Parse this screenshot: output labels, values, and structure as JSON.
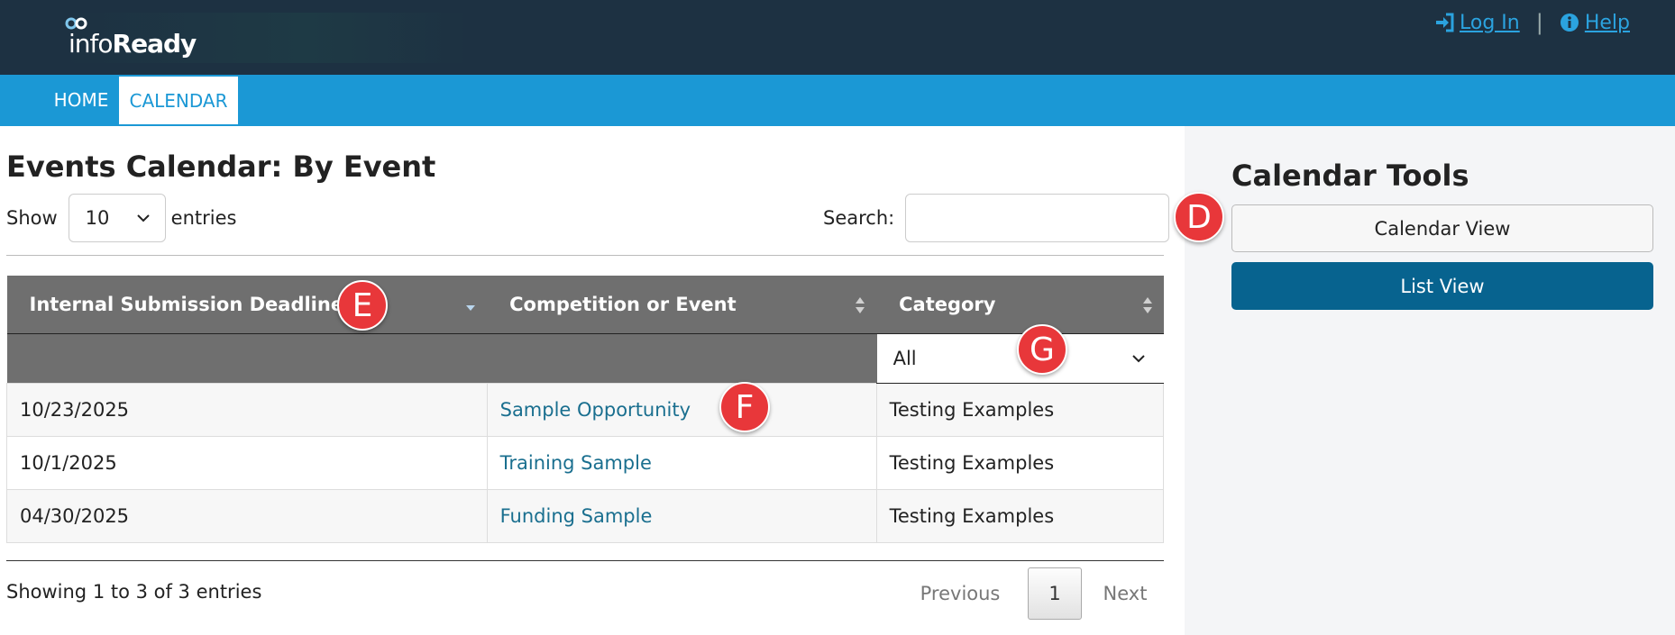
{
  "header": {
    "logo_text_light": "info",
    "logo_text_bold": "Ready",
    "login_label": "Log In",
    "separator": "|",
    "help_label": "Help"
  },
  "nav": {
    "items": [
      {
        "label": "HOME",
        "active": false
      },
      {
        "label": "CALENDAR",
        "active": true
      }
    ]
  },
  "main": {
    "title": "Events Calendar: By Event",
    "show_label": "Show",
    "entries_value": "10",
    "entries_label": "entries",
    "search_label": "Search:",
    "search_value": "",
    "columns": [
      "Internal Submission Deadline",
      "Competition or Event",
      "Category"
    ],
    "category_filter": "All",
    "rows": [
      {
        "deadline": "10/23/2025",
        "event": "Sample Opportunity",
        "category": "Testing Examples"
      },
      {
        "deadline": "10/1/2025",
        "event": "Training Sample",
        "category": "Testing Examples"
      },
      {
        "deadline": "04/30/2025",
        "event": "Funding Sample",
        "category": "Testing Examples"
      }
    ],
    "info_text": "Showing 1 to 3 of 3 entries",
    "pager": {
      "previous": "Previous",
      "current": "1",
      "next": "Next"
    }
  },
  "sidebar": {
    "title": "Calendar Tools",
    "calendar_view_label": "Calendar View",
    "list_view_label": "List View"
  },
  "markers": {
    "d": "D",
    "e": "E",
    "f": "F",
    "g": "G"
  },
  "colors": {
    "header_bg": "#1d3142",
    "nav_bg": "#1b98d5",
    "table_header_bg": "#6f6f6f",
    "link": "#1a6f8f",
    "primary_button": "#07638f",
    "marker": "#e8373a"
  }
}
